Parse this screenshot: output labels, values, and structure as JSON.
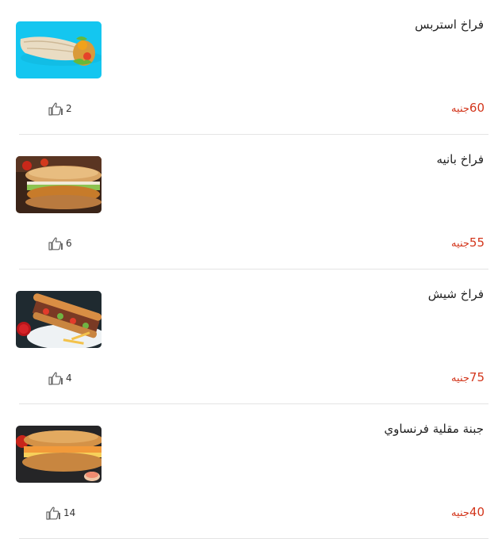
{
  "currency": "جنيه",
  "colors": {
    "price": "#d3361c",
    "divider": "#e4e4e4"
  },
  "items": [
    {
      "name": "فراخ استربس",
      "price": "60",
      "likes": "2",
      "image_icon": "wrap-sandwich-image"
    },
    {
      "name": "فراخ بانيه",
      "price": "55",
      "likes": "6",
      "image_icon": "panne-sandwich-image"
    },
    {
      "name": "فراخ شيش",
      "price": "75",
      "likes": "4",
      "image_icon": "shish-sandwich-image"
    },
    {
      "name": "جبنة مقلية فرنساوي",
      "price": "40",
      "likes": "14",
      "image_icon": "cheese-sandwich-image"
    }
  ]
}
